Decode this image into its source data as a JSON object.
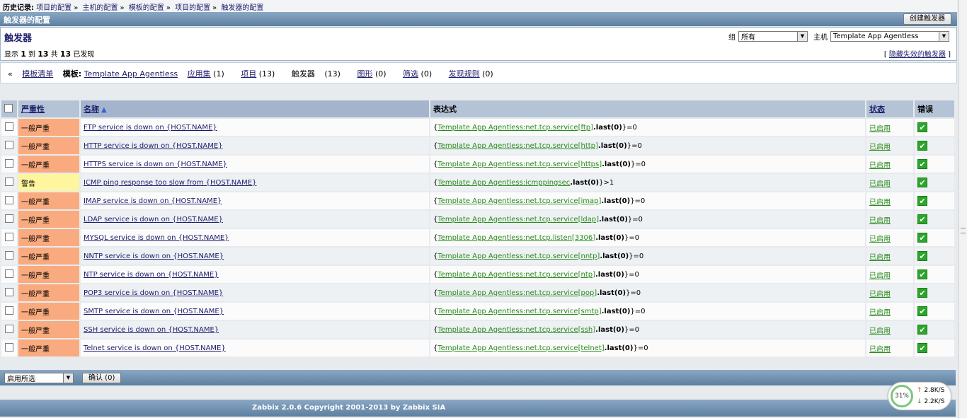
{
  "history": {
    "label": "历史记录:",
    "items": [
      "项目的配置",
      "主机的配置",
      "模板的配置",
      "项目的配置",
      "触发器的配置"
    ],
    "separator": "»"
  },
  "title_bar": {
    "title": "触发器的配置",
    "create_button": "创建触发器"
  },
  "header": {
    "page_title": "触发器",
    "display_prefix": "显示",
    "display_from": "1",
    "display_to_word": "到",
    "display_to": "13",
    "display_of_word": "共",
    "display_total": "13",
    "display_suffix": "已发现",
    "group_label": "组",
    "group_value": "所有",
    "host_label": "主机",
    "host_value": "Template App Agentless",
    "hide_disabled": "隐藏失效的触发器"
  },
  "nav": {
    "back_symbol": "«",
    "template_list": "模板清单",
    "template_label": "模板:",
    "template_name": "Template App Agentless",
    "apps": "应用集",
    "apps_count": "(1)",
    "items": "项目",
    "items_count": "(13)",
    "triggers": "触发器",
    "triggers_count": "(13)",
    "graphs": "图形",
    "graphs_count": "(0)",
    "screens": "筛选",
    "screens_count": "(0)",
    "discovery": "发现规则",
    "discovery_count": "(0)"
  },
  "table": {
    "headers": {
      "severity": "严重性",
      "name": "名称",
      "expression": "表达式",
      "status": "状态",
      "error": "错误"
    },
    "sort_icon": "arrow-up-icon",
    "rows": [
      {
        "severity": "一般严重",
        "sev_class": "sev-avg",
        "name": "FTP service is down on {HOST.NAME}",
        "expr_open": "{",
        "expr_link": "Template App Agentless:net.tcp.service[ftp]",
        "expr_func": ".last(0)",
        "expr_tail": "}=0",
        "status": "已启用"
      },
      {
        "severity": "一般严重",
        "sev_class": "sev-avg",
        "name": "HTTP service is down on {HOST.NAME}",
        "expr_open": "{",
        "expr_link": "Template App Agentless:net.tcp.service[http]",
        "expr_func": ".last(0)",
        "expr_tail": "}=0",
        "status": "已启用"
      },
      {
        "severity": "一般严重",
        "sev_class": "sev-avg",
        "name": "HTTPS service is down on {HOST.NAME}",
        "expr_open": "{",
        "expr_link": "Template App Agentless:net.tcp.service[https]",
        "expr_func": ".last(0)",
        "expr_tail": "}=0",
        "status": "已启用"
      },
      {
        "severity": "警告",
        "sev_class": "sev-warn",
        "name": "ICMP ping response too slow from {HOST.NAME}",
        "expr_open": "{",
        "expr_link": "Template App Agentless:icmppingsec",
        "expr_func": ".last(0)",
        "expr_tail": "}>1",
        "status": "已启用"
      },
      {
        "severity": "一般严重",
        "sev_class": "sev-avg",
        "name": "IMAP service is down on {HOST.NAME}",
        "expr_open": "{",
        "expr_link": "Template App Agentless:net.tcp.service[imap]",
        "expr_func": ".last(0)",
        "expr_tail": "}=0",
        "status": "已启用"
      },
      {
        "severity": "一般严重",
        "sev_class": "sev-avg",
        "name": "LDAP service is down on {HOST.NAME}",
        "expr_open": "{",
        "expr_link": "Template App Agentless:net.tcp.service[ldap]",
        "expr_func": ".last(0)",
        "expr_tail": "}=0",
        "status": "已启用"
      },
      {
        "severity": "一般严重",
        "sev_class": "sev-avg",
        "name": "MYSQL service is down on {HOST.NAME}",
        "expr_open": "{",
        "expr_link": "Template App Agentless:net.tcp.listen[3306]",
        "expr_func": ".last(0)",
        "expr_tail": "}=0",
        "status": "已启用"
      },
      {
        "severity": "一般严重",
        "sev_class": "sev-avg",
        "name": "NNTP service is down on {HOST.NAME}",
        "expr_open": "{",
        "expr_link": "Template App Agentless:net.tcp.service[nntp]",
        "expr_func": ".last(0)",
        "expr_tail": "}=0",
        "status": "已启用"
      },
      {
        "severity": "一般严重",
        "sev_class": "sev-avg",
        "name": "NTP service is down on {HOST.NAME}",
        "expr_open": "{",
        "expr_link": "Template App Agentless:net.tcp.service[ntp]",
        "expr_func": ".last(0)",
        "expr_tail": "}=0",
        "status": "已启用"
      },
      {
        "severity": "一般严重",
        "sev_class": "sev-avg",
        "name": "POP3 service is down on {HOST.NAME}",
        "expr_open": "{",
        "expr_link": "Template App Agentless:net.tcp.service[pop]",
        "expr_func": ".last(0)",
        "expr_tail": "}=0",
        "status": "已启用"
      },
      {
        "severity": "一般严重",
        "sev_class": "sev-avg",
        "name": "SMTP service is down on {HOST.NAME}",
        "expr_open": "{",
        "expr_link": "Template App Agentless:net.tcp.service[smtp]",
        "expr_func": ".last(0)",
        "expr_tail": "}=0",
        "status": "已启用"
      },
      {
        "severity": "一般严重",
        "sev_class": "sev-avg",
        "name": "SSH service is down on {HOST.NAME}",
        "expr_open": "{",
        "expr_link": "Template App Agentless:net.tcp.service[ssh]",
        "expr_func": ".last(0)",
        "expr_tail": "}=0",
        "status": "已启用"
      },
      {
        "severity": "一般严重",
        "sev_class": "sev-avg",
        "name": "Telnet service is down on {HOST.NAME}",
        "expr_open": "{",
        "expr_link": "Template App Agentless:net.tcp.service[telnet]",
        "expr_func": ".last(0)",
        "expr_tail": "}=0",
        "status": "已启用"
      }
    ]
  },
  "footer": {
    "action_select": "启用所选",
    "confirm_button": "确认 (0)",
    "copyright": "Zabbix 2.0.6 Copyright 2001-2013 by Zabbix SIA"
  },
  "net_widget": {
    "percent": "31%",
    "upload": "2.8K/S",
    "download": "2.2K/S"
  },
  "colors": {
    "severity_average": "#f9aa7e",
    "severity_warning": "#fdf69e",
    "enabled_green": "#2a8a1d",
    "header_blue": "#5d7f9f"
  }
}
